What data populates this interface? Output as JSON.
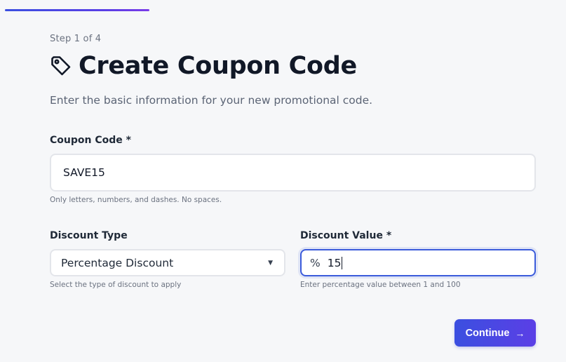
{
  "progress": {
    "value": 0.25,
    "color_start": "#3b4fe0",
    "color_end": "#7a3be8"
  },
  "step_text": "Step 1 of 4",
  "title": "Create Coupon Code",
  "title_icon": "tag-icon",
  "subtitle": "Enter the basic information for your new promotional code.",
  "coupon_code": {
    "label": "Coupon Code *",
    "value": "SAVE15",
    "help": "Only letters, numbers, and dashes. No spaces."
  },
  "discount_type": {
    "label": "Discount Type",
    "selected": "Percentage Discount",
    "help": "Select the type of discount to apply",
    "icon": "caret-down-icon"
  },
  "discount_value": {
    "label": "Discount Value *",
    "prefix": "%",
    "value": "15",
    "help": "Enter percentage value between 1 and 100",
    "focus_color": "#3b5bdb"
  },
  "continue_button": {
    "label": "Continue",
    "arrow": "→",
    "color": "#3b4fe0"
  }
}
